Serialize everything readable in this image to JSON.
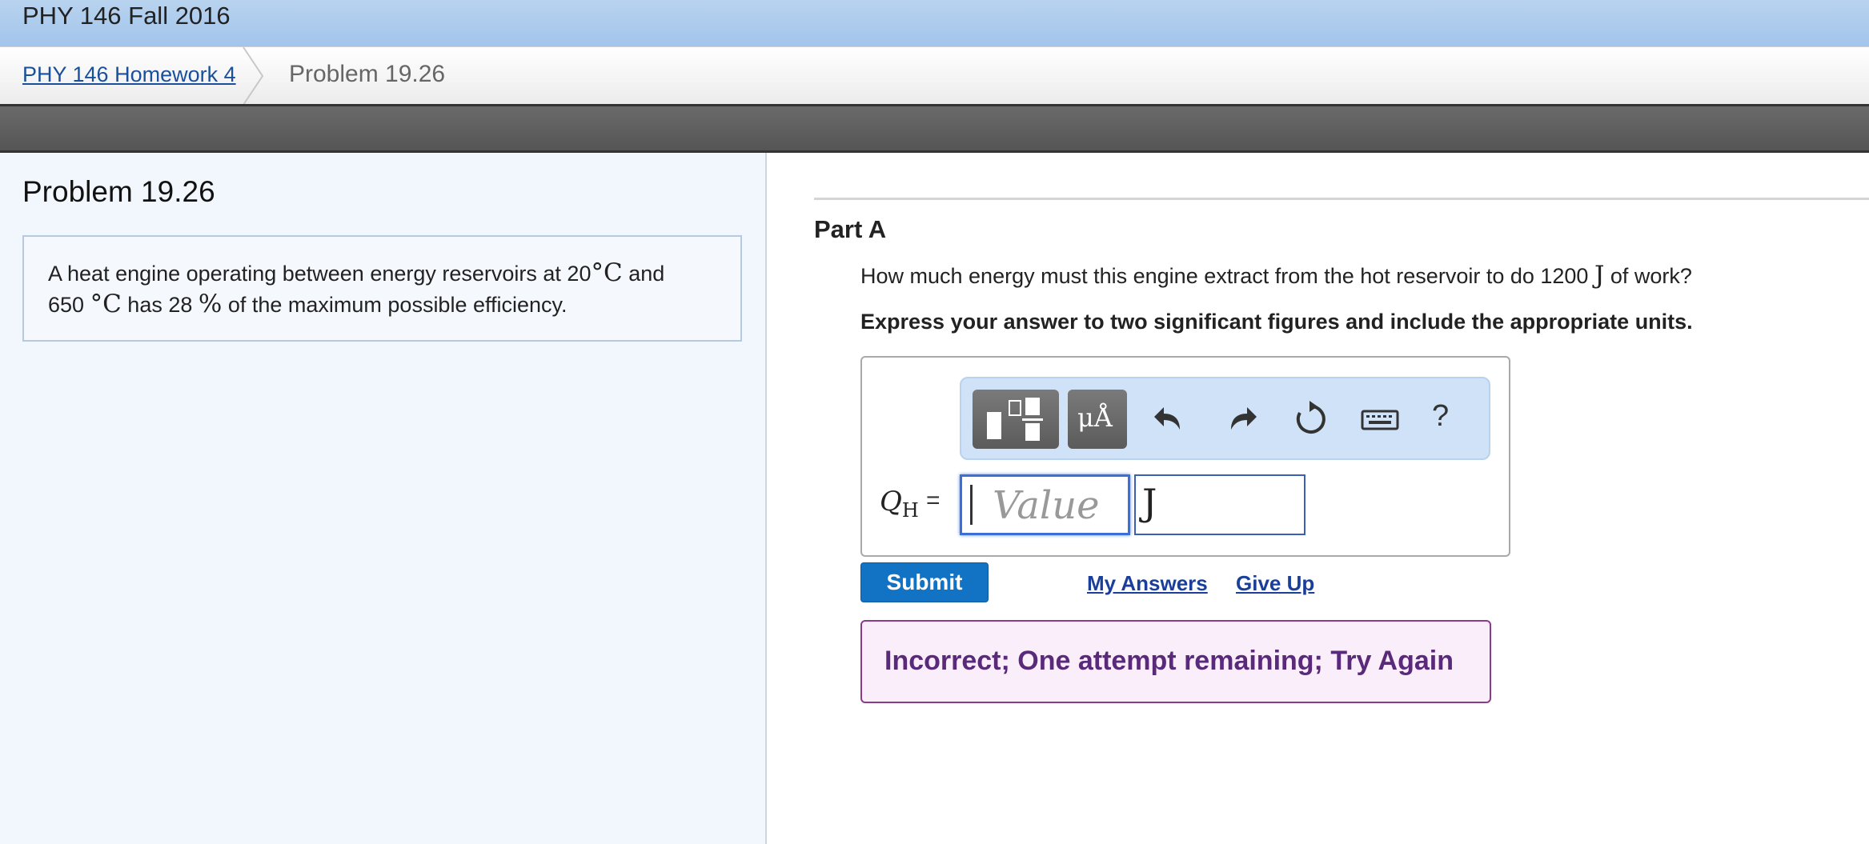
{
  "header": {
    "course_title": "PHY 146 Fall 2016"
  },
  "breadcrumb": {
    "parent": "PHY 146 Homework 4",
    "current": "Problem 19.26"
  },
  "problem": {
    "title": "Problem 19.26",
    "text_1": "A heat engine operating between energy reservoirs at 20",
    "deg_1": "°",
    "unit_c_1": "C",
    "text_2": " and",
    "text_3": "650 ",
    "deg_2": "°",
    "unit_c_2": "C",
    "text_4": " has 28 ",
    "percent": "%",
    "text_5": " of the maximum possible efficiency."
  },
  "part": {
    "title": "Part A",
    "question_pre": "How much energy must this engine extract from the hot reservoir to do 1200 ",
    "question_unit": "J",
    "question_post": " of work?",
    "instruction": "Express your answer to two significant figures and include the appropriate units."
  },
  "toolbar": {
    "templates_icon": "fraction-template-icon",
    "units_label": "μÅ",
    "undo_icon": "undo-icon",
    "redo_icon": "redo-icon",
    "reset_icon": "reset-icon",
    "keyboard_icon": "keyboard-icon",
    "help_label": "?"
  },
  "answer": {
    "var_main": "Q",
    "var_sub": "H",
    "equals": "=",
    "value_placeholder": "Value",
    "unit_value": "J"
  },
  "actions": {
    "submit": "Submit",
    "my_answers": "My Answers",
    "give_up": "Give Up"
  },
  "feedback": {
    "message": "Incorrect; One attempt remaining; Try Again"
  },
  "colors": {
    "accent": "#1273c4",
    "feedback_text": "#5a2a7a",
    "feedback_border": "#8a3b8a"
  }
}
